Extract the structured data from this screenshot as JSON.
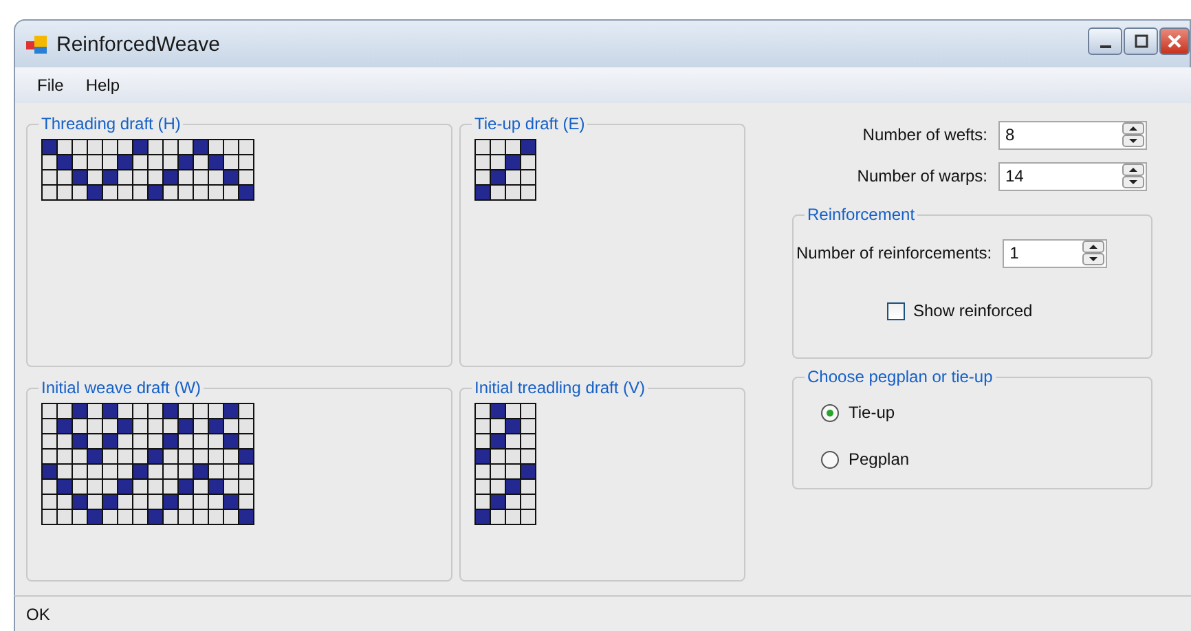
{
  "window": {
    "title": "ReinforcedWeave"
  },
  "menu": [
    {
      "label": "File"
    },
    {
      "label": "Help"
    }
  ],
  "drafts": [
    {
      "title": "Threading draft (H)",
      "grid": [
        [
          true,
          false,
          false,
          false,
          false,
          false,
          true,
          false,
          false,
          false,
          true,
          false,
          false,
          false
        ],
        [
          false,
          true,
          false,
          false,
          false,
          true,
          false,
          false,
          false,
          true,
          false,
          true,
          false,
          false
        ],
        [
          false,
          false,
          true,
          false,
          true,
          false,
          false,
          false,
          true,
          false,
          false,
          false,
          true,
          false
        ],
        [
          false,
          false,
          false,
          true,
          false,
          false,
          false,
          true,
          false,
          false,
          false,
          false,
          false,
          true
        ]
      ]
    },
    {
      "title": "Tie-up draft (E)",
      "grid": [
        [
          false,
          false,
          false,
          true
        ],
        [
          false,
          false,
          true,
          false
        ],
        [
          false,
          true,
          false,
          false
        ],
        [
          true,
          false,
          false,
          false
        ]
      ]
    },
    {
      "title": "Initial weave draft (W)",
      "grid": [
        [
          false,
          false,
          true,
          false,
          true,
          false,
          false,
          false,
          true,
          false,
          false,
          false,
          true,
          false
        ],
        [
          false,
          true,
          false,
          false,
          false,
          true,
          false,
          false,
          false,
          true,
          false,
          true,
          false,
          false
        ],
        [
          false,
          false,
          true,
          false,
          true,
          false,
          false,
          false,
          true,
          false,
          false,
          false,
          true,
          false
        ],
        [
          false,
          false,
          false,
          true,
          false,
          false,
          false,
          true,
          false,
          false,
          false,
          false,
          false,
          true
        ],
        [
          true,
          false,
          false,
          false,
          false,
          false,
          true,
          false,
          false,
          false,
          true,
          false,
          false,
          false
        ],
        [
          false,
          true,
          false,
          false,
          false,
          true,
          false,
          false,
          false,
          true,
          false,
          true,
          false,
          false
        ],
        [
          false,
          false,
          true,
          false,
          true,
          false,
          false,
          false,
          true,
          false,
          false,
          false,
          true,
          false
        ],
        [
          false,
          false,
          false,
          true,
          false,
          false,
          false,
          true,
          false,
          false,
          false,
          false,
          false,
          true
        ]
      ]
    },
    {
      "title": "Initial treadling draft (V)",
      "grid": [
        [
          false,
          true,
          false,
          false
        ],
        [
          false,
          false,
          true,
          false
        ],
        [
          false,
          true,
          false,
          false
        ],
        [
          true,
          false,
          false,
          false
        ],
        [
          false,
          false,
          false,
          true
        ],
        [
          false,
          false,
          true,
          false
        ],
        [
          false,
          true,
          false,
          false
        ],
        [
          true,
          false,
          false,
          false
        ]
      ]
    }
  ],
  "settings": [
    {
      "label": "Number of wefts:",
      "value": "8"
    },
    {
      "label": "Number of warps:",
      "value": "14"
    }
  ],
  "reinforcement": {
    "title": "Reinforcement",
    "label": "Number of reinforcements:",
    "value": "1",
    "show_reinforced": {
      "label": "Show reinforced",
      "checked": false
    }
  },
  "choice": {
    "title": "Choose pegplan or tie-up",
    "options": [
      {
        "label": "Tie-up",
        "selected": true
      },
      {
        "label": "Pegplan",
        "selected": false
      }
    ]
  },
  "status_bar": {
    "text": "OK"
  }
}
